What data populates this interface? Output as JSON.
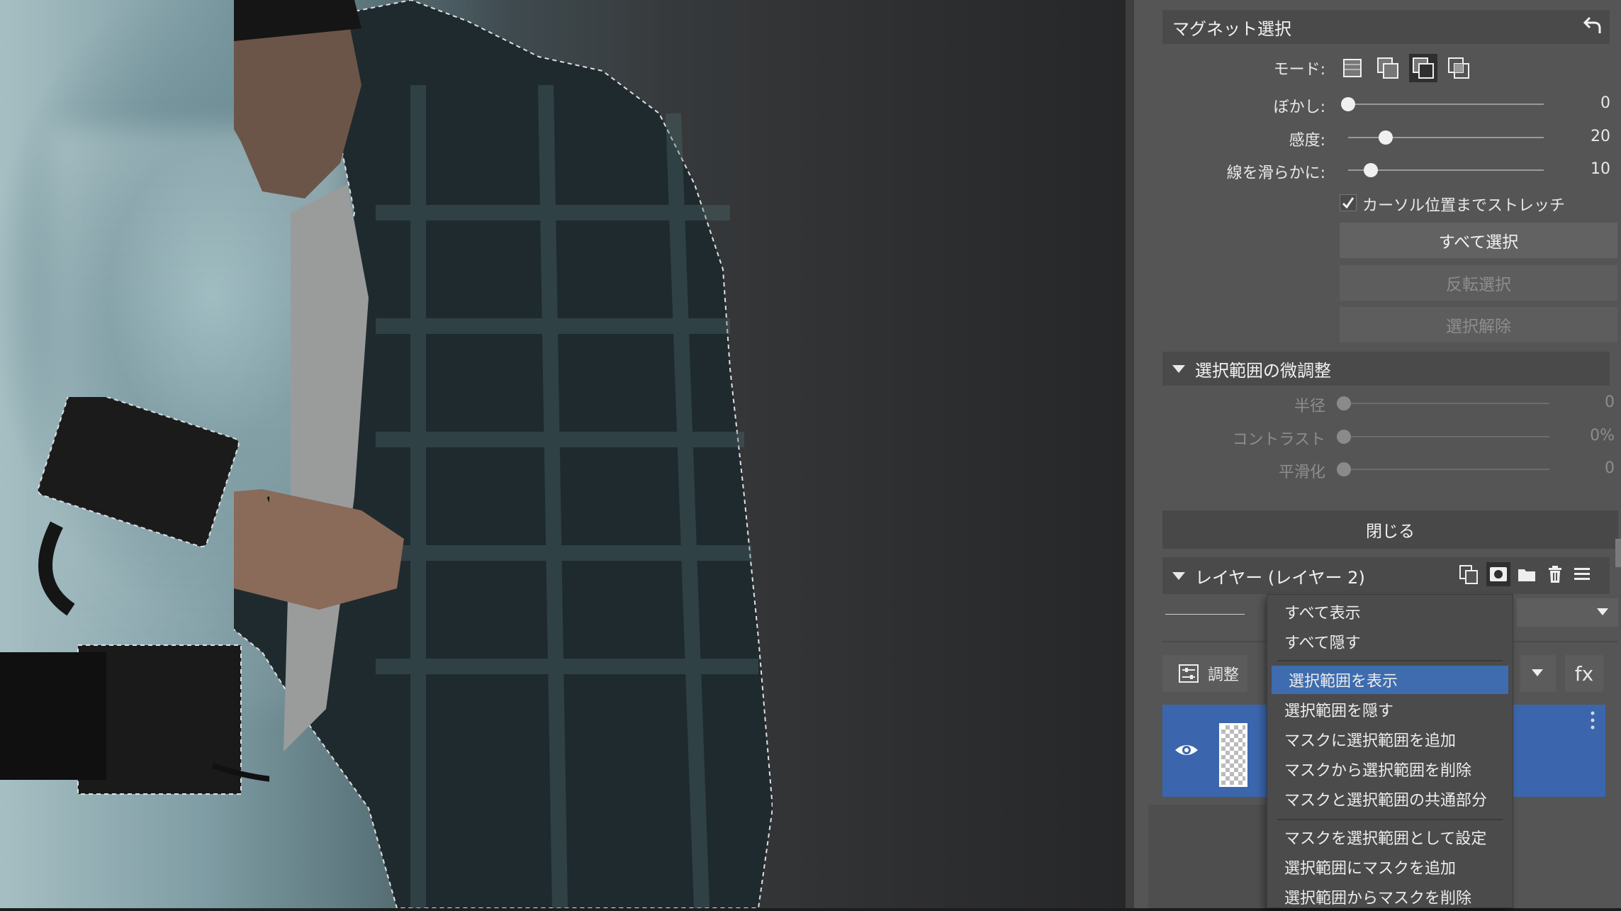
{
  "magnet": {
    "title": "マグネット選択",
    "mode_label": "モード:",
    "modes": [
      "new-selection-icon",
      "add-selection-icon",
      "subtract-selection-icon",
      "intersect-selection-icon"
    ],
    "active_mode": 2,
    "blur_label": "ぼかし:",
    "blur_value": "0",
    "blur_fraction": 0.0,
    "sensitivity_label": "感度:",
    "sensitivity_value": "20",
    "sensitivity_fraction": 0.2,
    "smooth_label": "線を滑らかに:",
    "smooth_value": "10",
    "smooth_fraction": 0.12,
    "stretch_label": "カーソル位置までストレッチ",
    "stretch_checked": true,
    "select_all": "すべて選択",
    "invert": "反転選択",
    "deselect": "選択解除"
  },
  "refine": {
    "title": "選択範囲の微調整",
    "radius_label": "半径",
    "radius_value": "0",
    "contrast_label": "コントラスト",
    "contrast_value": "0%",
    "smoothing_label": "平滑化",
    "smoothing_value": "0"
  },
  "close_button": "閉じる",
  "layers": {
    "title": "レイヤー (レイヤー 2)",
    "adjust_label": "調整",
    "fx_label": "fx"
  },
  "context_menu": {
    "items": [
      "すべて表示",
      "すべて隠す",
      "選択範囲を表示",
      "選択範囲を隠す",
      "マスクに選択範囲を追加",
      "マスクから選択範囲を削除",
      "マスクと選択範囲の共通部分",
      "マスクを選択範囲として設定",
      "選択範囲にマスクを追加",
      "選択範囲からマスクを削除"
    ],
    "selected_index": 2
  },
  "colors": {
    "panel_bg": "#555555",
    "highlight": "#3e6cae",
    "layer_selected": "#3b66ad"
  }
}
